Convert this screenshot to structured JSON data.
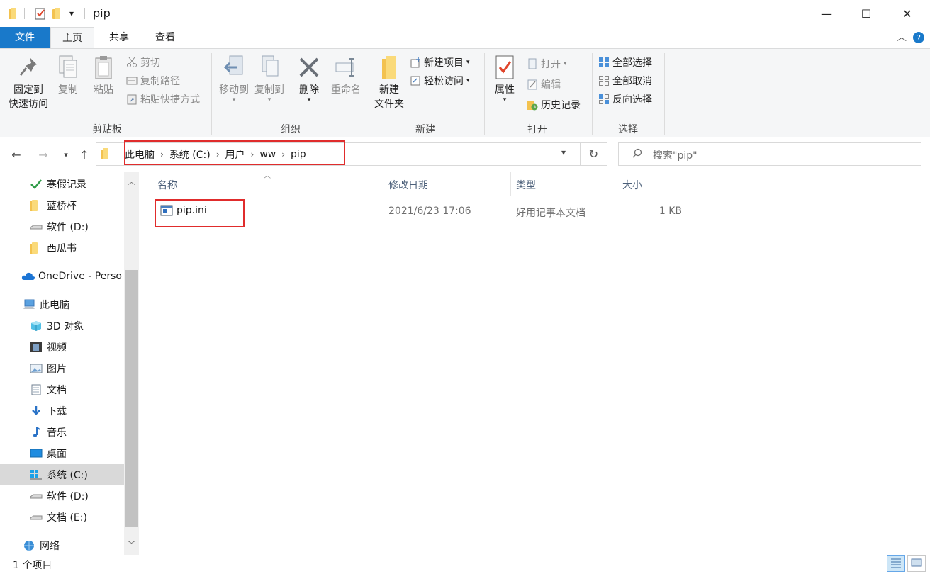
{
  "window": {
    "title": "pip",
    "quick_access_dropdown": "▾",
    "minimize": "—",
    "maximize": "☐",
    "close": "✕"
  },
  "tabs": {
    "file": "文件",
    "home": "主页",
    "share": "共享",
    "view": "查看"
  },
  "ribbon": {
    "clipboard": {
      "label": "剪贴板",
      "pin_line1": "固定到",
      "pin_line2": "快速访问",
      "copy": "复制",
      "paste": "粘贴",
      "cut": "剪切",
      "copy_path": "复制路径",
      "paste_shortcut": "粘贴快捷方式"
    },
    "organize": {
      "label": "组织",
      "move_to": "移动到",
      "copy_to": "复制到",
      "delete": "删除",
      "rename": "重命名"
    },
    "new": {
      "label": "新建",
      "new_folder_line1": "新建",
      "new_folder_line2": "文件夹",
      "new_item": "新建项目",
      "easy_access": "轻松访问"
    },
    "open": {
      "label": "打开",
      "properties": "属性",
      "open": "打开",
      "edit": "编辑",
      "history": "历史记录"
    },
    "select": {
      "label": "选择",
      "select_all": "全部选择",
      "select_none": "全部取消",
      "invert": "反向选择"
    }
  },
  "address": {
    "crumbs": [
      "此电脑",
      "系统 (C:)",
      "用户",
      "ww",
      "pip"
    ],
    "search_placeholder": "搜索\"pip\""
  },
  "nav": {
    "quick": [
      "寒假记录",
      "蓝桥杯",
      "软件 (D:)",
      "西瓜书"
    ],
    "onedrive": "OneDrive - Perso",
    "this_pc": "此电脑",
    "pc_items": [
      "3D 对象",
      "视频",
      "图片",
      "文档",
      "下载",
      "音乐",
      "桌面",
      "系统 (C:)",
      "软件 (D:)",
      "文档 (E:)"
    ],
    "network": "网络"
  },
  "columns": {
    "name": "名称",
    "modified": "修改日期",
    "type": "类型",
    "size": "大小"
  },
  "files": [
    {
      "name": "pip.ini",
      "modified": "2021/6/23 17:06",
      "type": "好用记事本文档",
      "size": "1 KB"
    }
  ],
  "status": {
    "count": "1 个项目"
  },
  "colors": {
    "file_tab": "#1979ca",
    "highlight": "#e02c2c",
    "folder": "#f3c24f"
  }
}
